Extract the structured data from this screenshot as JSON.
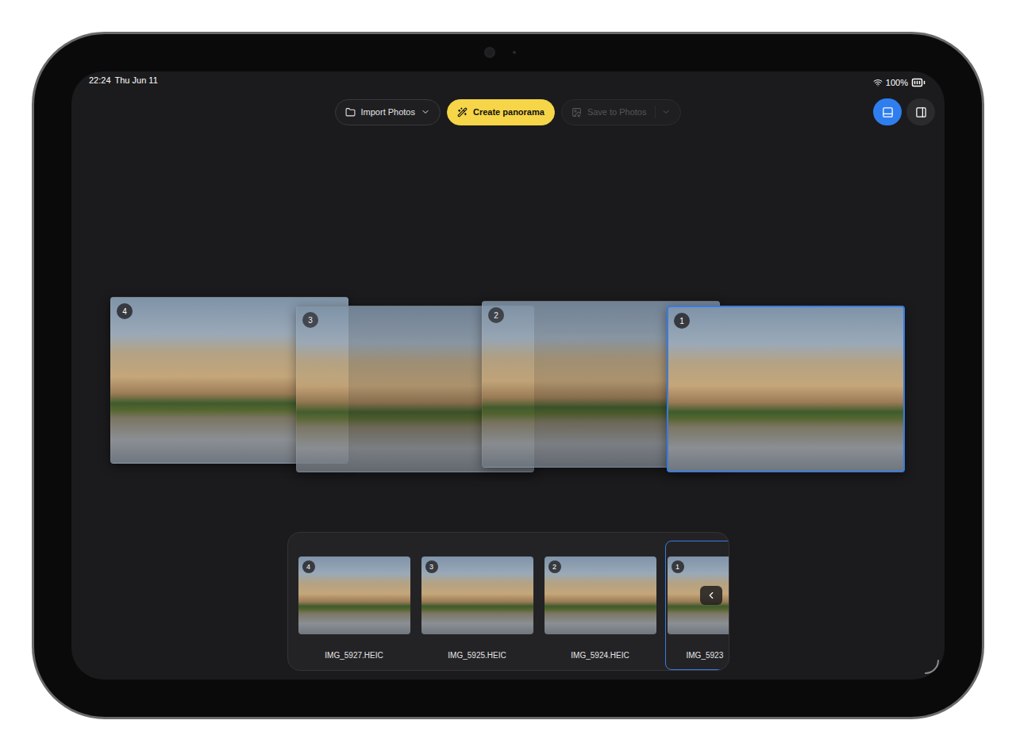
{
  "status_bar": {
    "time": "22:24",
    "date": "Thu Jun 11",
    "battery": "100%"
  },
  "toolbar": {
    "buttons": [
      {
        "label": "Import Photos",
        "kind": "menu",
        "disabled": false
      },
      {
        "label": "Create panorama",
        "kind": "primary",
        "disabled": false
      },
      {
        "label": "Save to Photos",
        "kind": "save",
        "disabled": true
      }
    ]
  },
  "view_toggle": [
    {
      "kind": "strip",
      "selected": true
    },
    {
      "kind": "sidebar",
      "selected": false
    }
  ],
  "canvas": {
    "photos": [
      {
        "badge": "4",
        "selected": false
      },
      {
        "badge": "3",
        "selected": false
      },
      {
        "badge": "2",
        "selected": false
      },
      {
        "badge": "1",
        "selected": true
      }
    ]
  },
  "strip": {
    "items": [
      {
        "badge": "4",
        "label": "IMG_5927.HEIC",
        "selected": false
      },
      {
        "badge": "3",
        "label": "IMG_5925.HEIC",
        "selected": false
      },
      {
        "badge": "2",
        "label": "IMG_5924.HEIC",
        "selected": false
      },
      {
        "badge": "1",
        "label": "IMG_5923",
        "selected": true
      }
    ]
  }
}
